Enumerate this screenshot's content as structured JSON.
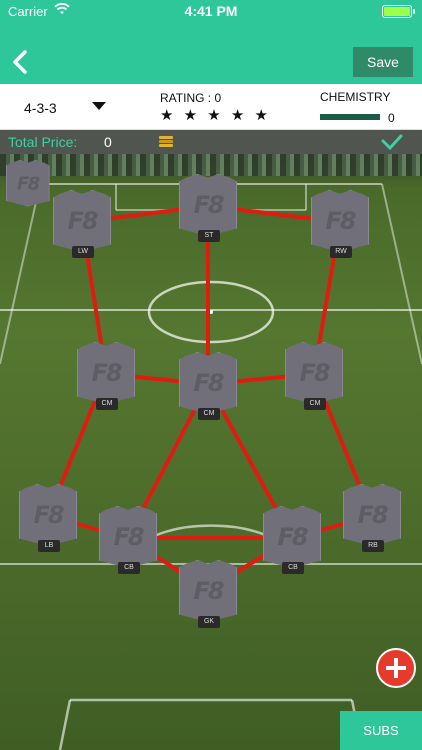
{
  "status": {
    "carrier": "Carrier",
    "time": "4:41 PM"
  },
  "nav": {
    "save_label": "Save"
  },
  "info": {
    "formation": "4-3-3",
    "rating_label": "RATING : 0",
    "stars": "★ ★ ★ ★ ★",
    "chemistry_label": "CHEMISTRY",
    "chemistry_value": "0"
  },
  "price": {
    "label": "Total Price:",
    "value": "0"
  },
  "card_logo": "F8",
  "positions": {
    "lw": "LW",
    "st": "ST",
    "rw": "RW",
    "cm_left": "CM",
    "cm_center": "CM",
    "cm_right": "CM",
    "lb": "LB",
    "cb_left": "CB",
    "cb_right": "CB",
    "rb": "RB",
    "gk": "GK"
  },
  "subs_label": "SUBS",
  "colors": {
    "accent": "#2ec79a",
    "link_line": "#e01b12",
    "add_button": "#e53a2c"
  }
}
